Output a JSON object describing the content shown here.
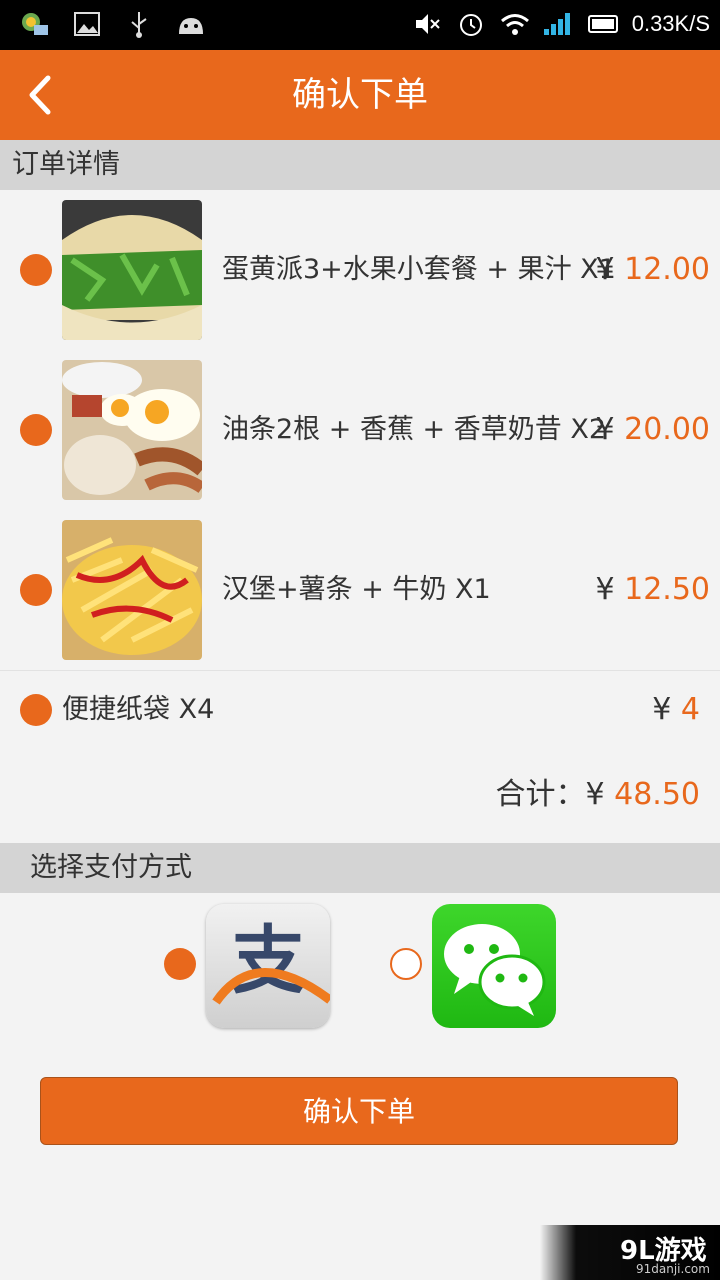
{
  "status_bar": {
    "left_icons": [
      "notification-app-icon",
      "image-icon",
      "usb-icon",
      "android-debug-icon"
    ],
    "right_icons": [
      "mute-icon",
      "alarm-icon",
      "wifi-icon",
      "signal-icon",
      "battery-icon"
    ],
    "net_speed": "0.33K/S"
  },
  "header": {
    "title": "确认下单"
  },
  "order_section": {
    "label": "订单详情",
    "items": [
      {
        "name": "蛋黄派3+水果小套餐 + 果汁 X1",
        "currency": "¥",
        "price": "12.00"
      },
      {
        "name": "油条2根 + 香蕉 + 香草奶昔 X2",
        "currency": "¥",
        "price": "20.00"
      },
      {
        "name": "汉堡+薯条 + 牛奶 X1",
        "currency": "¥",
        "price": "12.50"
      }
    ],
    "bag": {
      "name": "便捷纸袋 X4",
      "currency": "¥",
      "price": "4"
    },
    "total": {
      "label": "合计：",
      "currency": "¥",
      "value": "48.50"
    }
  },
  "payment_section": {
    "label": "选择支付方式",
    "methods": [
      {
        "icon": "alipay-icon",
        "glyph": "支",
        "selected": true
      },
      {
        "icon": "wechat-icon",
        "selected": false
      }
    ]
  },
  "confirm_button": {
    "label": "确认下单"
  },
  "watermark": {
    "logo": "9L游戏",
    "site": "91danji.com"
  },
  "colors": {
    "accent": "#e8681c",
    "section_bg": "#d4d4d4",
    "page_bg": "#f3f3f3"
  }
}
